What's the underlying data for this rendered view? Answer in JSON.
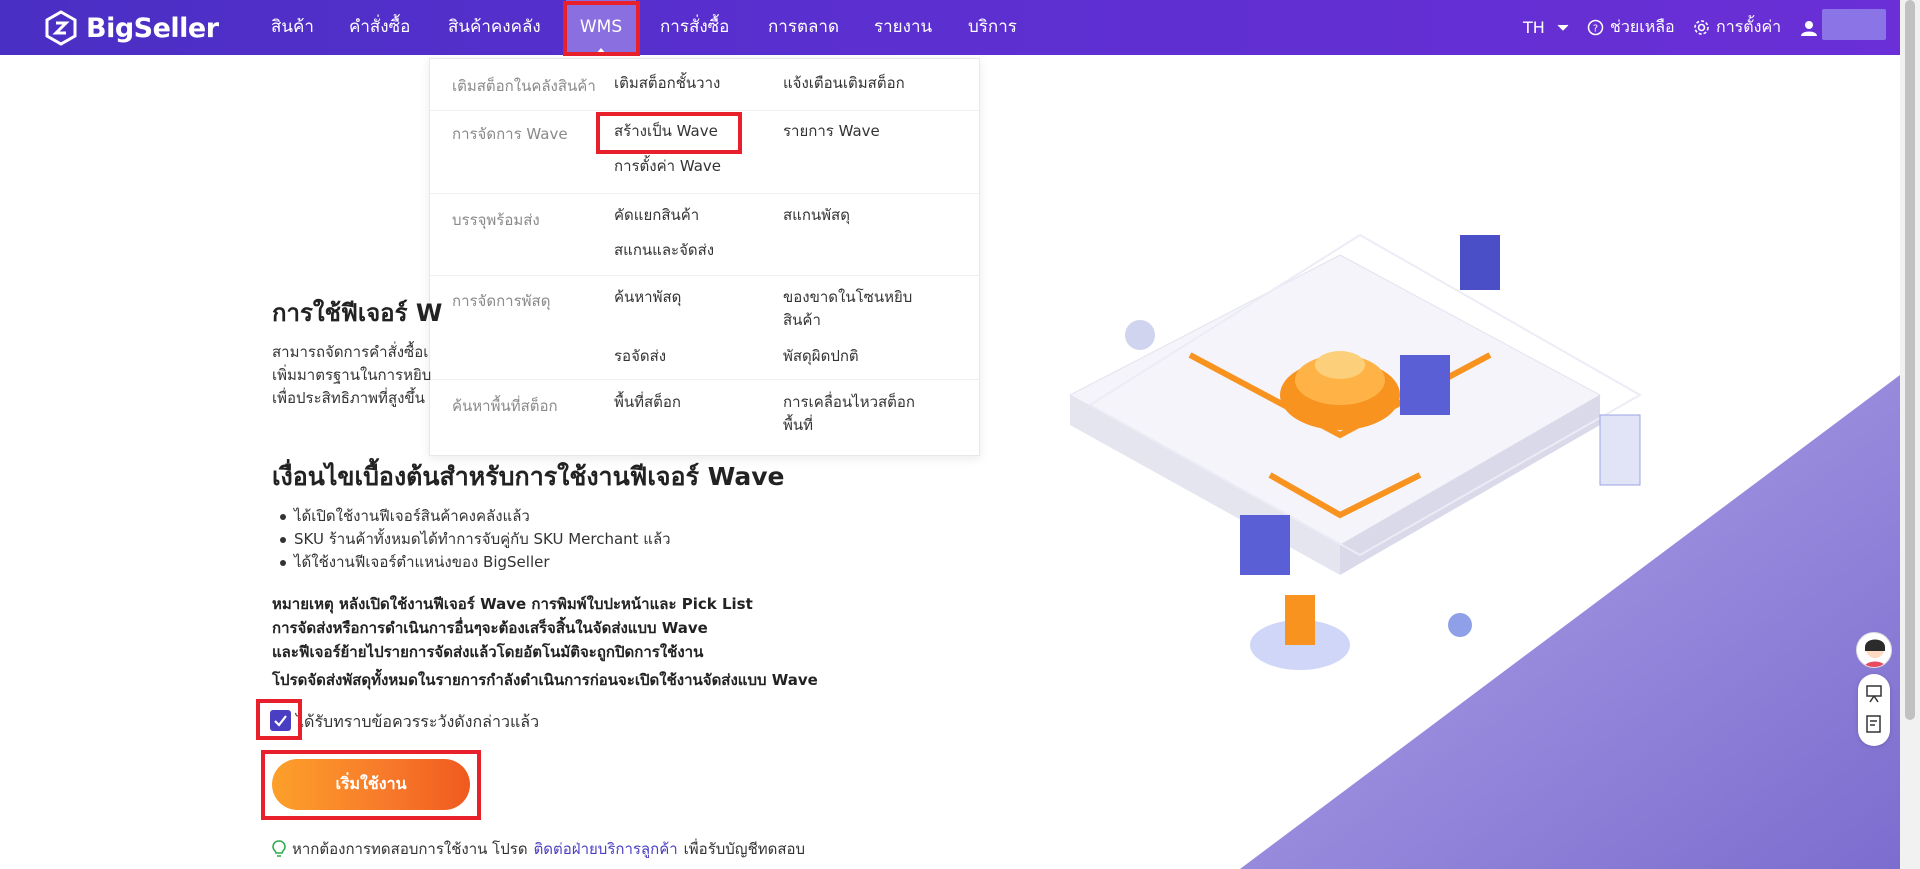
{
  "app": {
    "name": "BigSeller"
  },
  "nav": {
    "items": [
      {
        "label": "สินค้า"
      },
      {
        "label": "คำสั่งซื้อ"
      },
      {
        "label": "สินค้าคงคลัง"
      },
      {
        "label": "WMS"
      },
      {
        "label": "การสั่งซื้อ"
      },
      {
        "label": "การตลาด"
      },
      {
        "label": "รายงาน"
      },
      {
        "label": "บริการ"
      }
    ],
    "language": "TH",
    "help": "ช่วยเหลือ",
    "settings": "การตั้งค่า"
  },
  "dropdown": {
    "rows": [
      {
        "category": "เติมสต็อกในคลังสินค้า",
        "links": [
          "เติมสต็อกชั้นวาง",
          "แจ้งเตือนเติมสต็อก"
        ]
      },
      {
        "category": "การจัดการ Wave",
        "links": [
          "สร้างเป็น Wave",
          "รายการ Wave",
          "การตั้งค่า Wave"
        ]
      },
      {
        "category": "บรรจุพร้อมส่ง",
        "links": [
          "คัดแยกสินค้า",
          "สแกนพัสดุ",
          "สแกนและจัดส่ง"
        ]
      },
      {
        "category": "การจัดการพัสดุ",
        "links": [
          "ค้นหาพัสดุ",
          "ของขาดในโซนหยิบสินค้า",
          "รอจัดส่ง",
          "พัสดุผิดปกติ"
        ]
      },
      {
        "category": "ค้นหาพื้นที่สต็อก",
        "links": [
          "พื้นที่สต็อก",
          "การเคลื่อนไหวสต็อกพื้นที่"
        ]
      }
    ]
  },
  "main": {
    "title": "การใช้ฟีเจอร์ W",
    "intro_lines": [
      "สามารถจัดการคำสั่งซื้อเ",
      "เพิ่มมาตรฐานในการหยิบ",
      "เพื่อประสิทธิภาพที่สูงขึ้น"
    ],
    "conditions_title": "เงื่อนไขเบื้องต้นสำหรับการใช้งานฟีเจอร์ Wave",
    "conditions": [
      "ได้เปิดใช้งานฟีเจอร์สินค้าคงคลังแล้ว",
      "SKU ร้านค้าทั้งหมดได้ทำการจับคู่กับ SKU Merchant แล้ว",
      "ได้ใช้งานฟีเจอร์ตำแหน่งของ BigSeller"
    ],
    "note_lines": [
      "หมายเหตุ หลังเปิดใช้งานฟีเจอร์ Wave การพิมพ์ใบปะหน้าและ Pick List",
      "การจัดส่งหรือการดำเนินการอื่นๆจะต้องเสร็จสิ้นในจัดส่งแบบ Wave",
      "และฟีเจอร์ย้ายไปรายการจัดส่งแล้วโดยอัตโนมัติจะถูกปิดการใช้งาน"
    ],
    "note_final": "โปรดจัดส่งพัสดุทั้งหมดในรายการกำลังดำเนินการก่อนจะเปิดใช้งานจัดส่งแบบ Wave",
    "acknowledge": "ได้รับทราบข้อควรระวังดังกล่าวแล้ว",
    "start_button": "เริ่มใช้งาน",
    "tip_prefix": "หากต้องการทดสอบการใช้งาน โปรด",
    "tip_link": "ติดต่อฝ่ายบริการลูกค้า",
    "tip_suffix": "เพื่อรับบัญชีทดสอบ"
  },
  "colors": {
    "nav_bg": "#5b2fd0",
    "accent": "#4a3ec2",
    "highlight": "#e8202b",
    "button": "#f7782a"
  }
}
